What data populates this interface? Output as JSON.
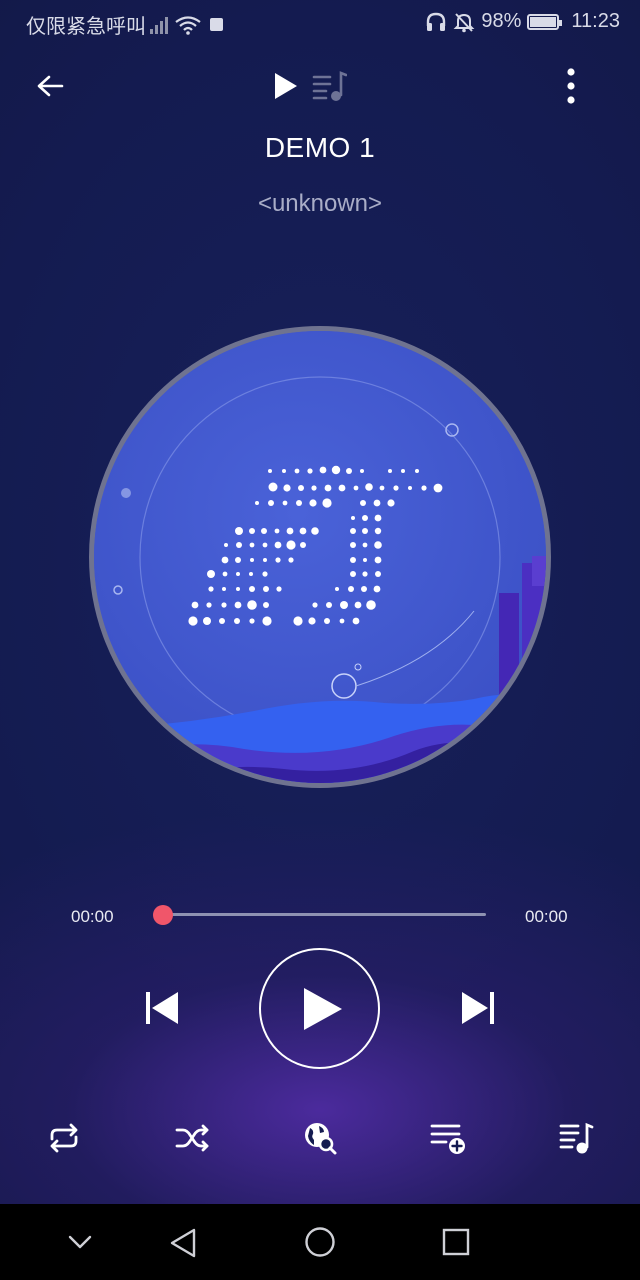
{
  "status_bar": {
    "left_text": "仅限紧急呼叫",
    "battery": "98%",
    "time": "11:23"
  },
  "player": {
    "title": "DEMO 1",
    "artist": "<unknown>",
    "elapsed": "00:00",
    "duration": "00:00",
    "progress": 0
  },
  "colors": {
    "accent": "#f0566a",
    "background": "#141b50",
    "disc": "#3e55cc"
  },
  "icons": {
    "back": "arrow-left-icon",
    "play_small": "play-icon",
    "queue_tab": "playlist-icon",
    "more": "more-vertical-icon",
    "previous": "skip-previous-icon",
    "play": "play-icon",
    "next": "skip-next-icon",
    "repeat": "repeat-icon",
    "shuffle": "shuffle-icon",
    "search_web": "globe-search-icon",
    "add_to_playlist": "playlist-add-icon",
    "queue": "queue-music-icon"
  }
}
